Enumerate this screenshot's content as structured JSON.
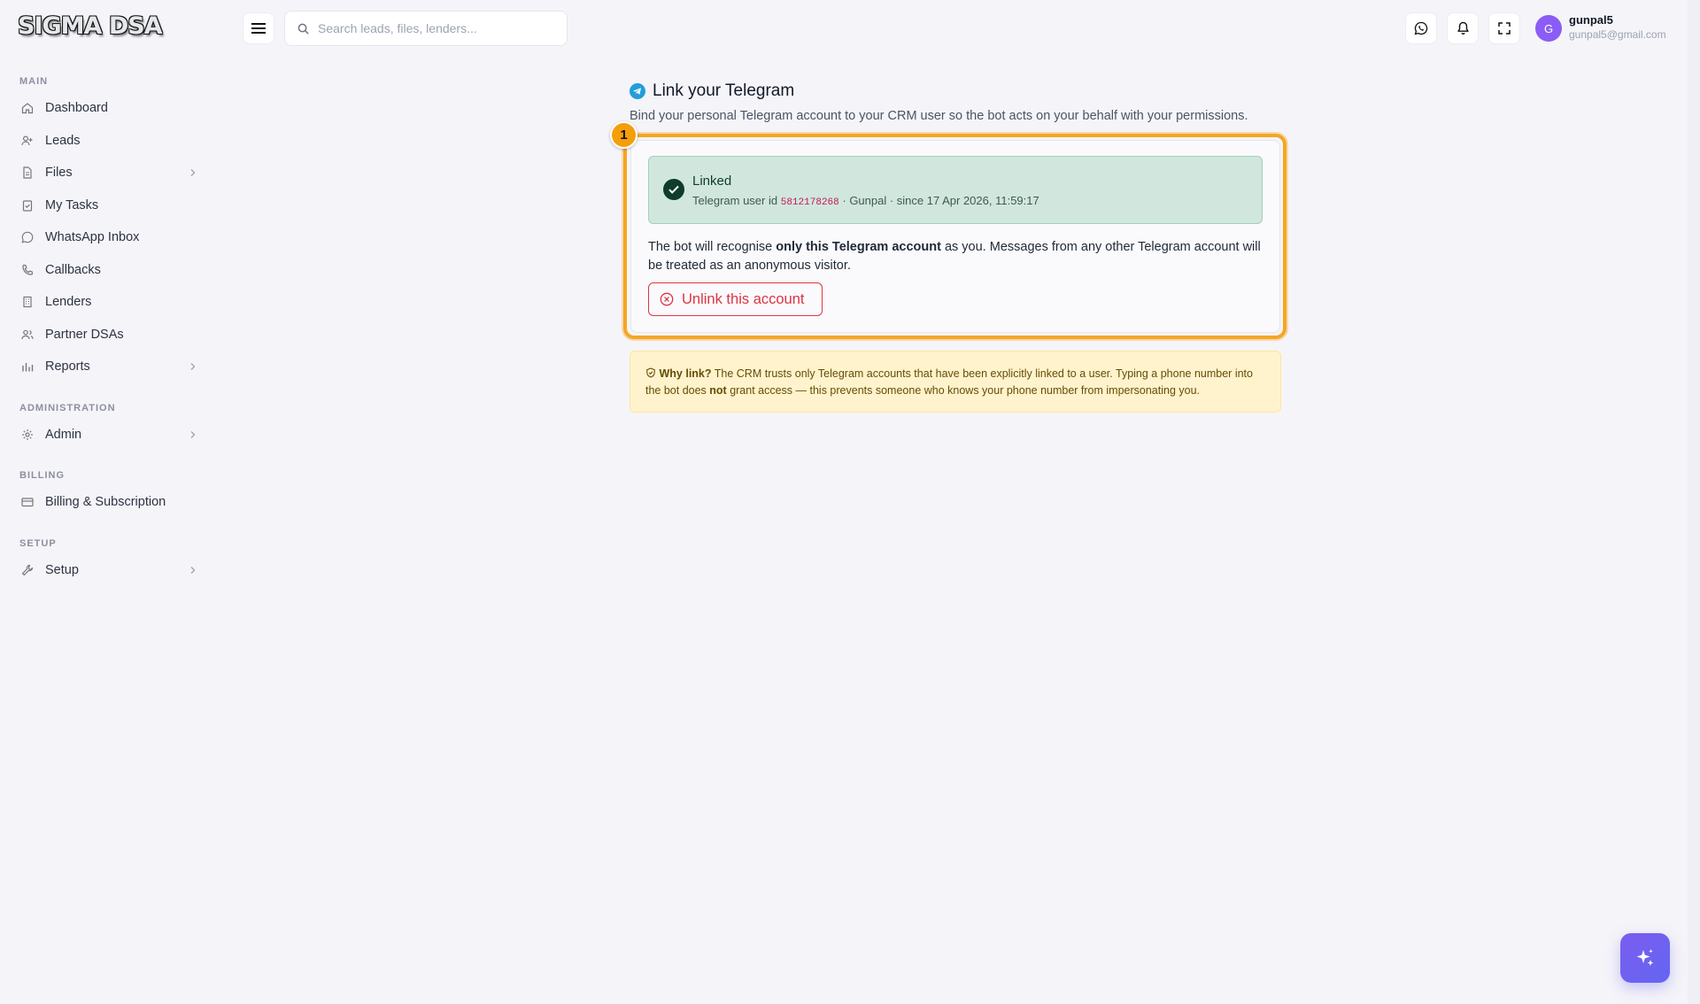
{
  "brand": {
    "logo_text": "SIGMA DSA"
  },
  "topbar": {
    "search_placeholder": "Search leads, files, lenders...",
    "user": {
      "initial": "G",
      "name": "gunpal5",
      "email": "gunpal5@gmail.com"
    },
    "icons": [
      "whatsapp-icon",
      "bell-icon",
      "fullscreen-icon"
    ]
  },
  "sidebar": {
    "main_label": "MAIN",
    "main_items": [
      {
        "label": "Dashboard",
        "icon": "home-icon"
      },
      {
        "label": "Leads",
        "icon": "user-plus-icon"
      },
      {
        "label": "Files",
        "icon": "file-icon",
        "chevron": true
      },
      {
        "label": "My Tasks",
        "icon": "clipboard-check-icon"
      },
      {
        "label": "WhatsApp Inbox",
        "icon": "whatsapp-icon"
      },
      {
        "label": "Callbacks",
        "icon": "phone-icon"
      },
      {
        "label": "Lenders",
        "icon": "building-icon"
      },
      {
        "label": "Partner DSAs",
        "icon": "users-icon"
      },
      {
        "label": "Reports",
        "icon": "bar-chart-icon",
        "chevron": true
      }
    ],
    "admin_label": "ADMINISTRATION",
    "admin_item": "Admin",
    "billing_label": "BILLING",
    "billing_item": "Billing & Subscription",
    "setup_label": "SETUP",
    "setup_item": "Setup"
  },
  "page": {
    "title": "Link your Telegram",
    "subtitle": "Bind your personal Telegram account to your CRM user so the bot acts on your behalf with your permissions.",
    "step_badge": "1",
    "linked": {
      "title": "Linked",
      "meta_prefix": "Telegram user id",
      "user_id": "5812178268",
      "meta_suffix": "· Gunpal · since 17 Apr 2026, 11:59:17"
    },
    "info": {
      "part1": "The bot will recognise ",
      "bold": "only this Telegram account",
      "part2": " as you. Messages from any other Telegram account will be treated as an anonymous visitor."
    },
    "unlink_label": "Unlink this account",
    "why": {
      "bold_lead": "Why link?",
      "part1": " The CRM trusts only Telegram accounts that have been explicitly linked to a user. Typing a phone number into the bot does ",
      "bold_not": "not",
      "part2": " grant access — this prevents someone who knows your phone number from impersonating you."
    }
  },
  "colors": {
    "accent": "#f5a623",
    "linked_bg": "#d1e7dd",
    "danger": "#dc3545",
    "warning_bg": "#fff3cd",
    "avatar": "#8b5cf6"
  }
}
